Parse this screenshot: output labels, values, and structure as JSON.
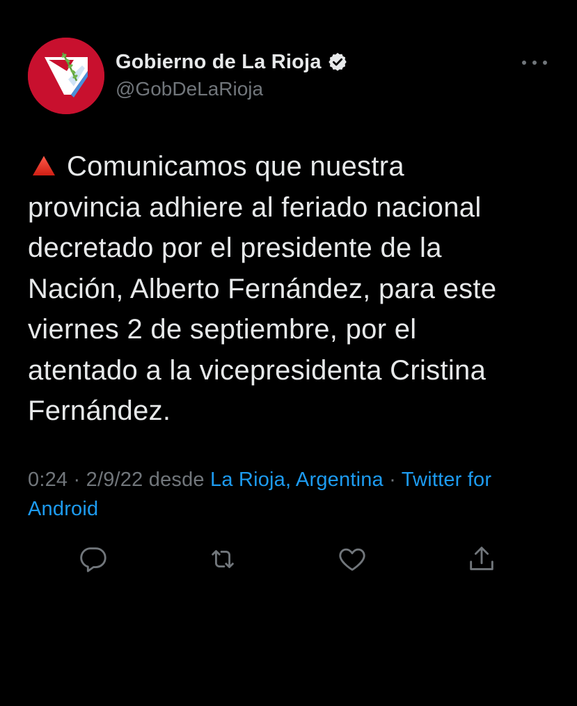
{
  "author": {
    "display_name": "Gobierno de La Rioja",
    "handle": "@GobDeLaRioja",
    "verified": true,
    "avatar_colors": {
      "background": "#c8102e",
      "emblem": "#ffffff",
      "accent": "#4a90d9",
      "leaf": "#5a9e3a"
    }
  },
  "tweet": {
    "emoji": "red-triangle-pointed-up",
    "lines": [
      "Comunicamos que nuestra",
      "provincia adhiere al feriado nacional",
      "decretado por el presidente de la",
      "Nación, Alberto Fernández, para este",
      "viernes 2 de septiembre, por el",
      "atentado a la vicepresidenta Cristina",
      "Fernández."
    ]
  },
  "meta": {
    "time": "0:24",
    "separator": "·",
    "date": "2/9/22",
    "from_word": "desde",
    "location": "La Rioja, Argentina",
    "source_line1": "Twitter for",
    "source_line2": "Android"
  },
  "actions": [
    {
      "name": "reply",
      "icon": "reply-icon"
    },
    {
      "name": "retweet",
      "icon": "retweet-icon"
    },
    {
      "name": "like",
      "icon": "heart-icon"
    },
    {
      "name": "share",
      "icon": "share-icon"
    }
  ],
  "colors": {
    "background": "#000000",
    "text_primary": "#e7e9ea",
    "text_secondary": "#71767b",
    "link": "#1d9bf0"
  }
}
